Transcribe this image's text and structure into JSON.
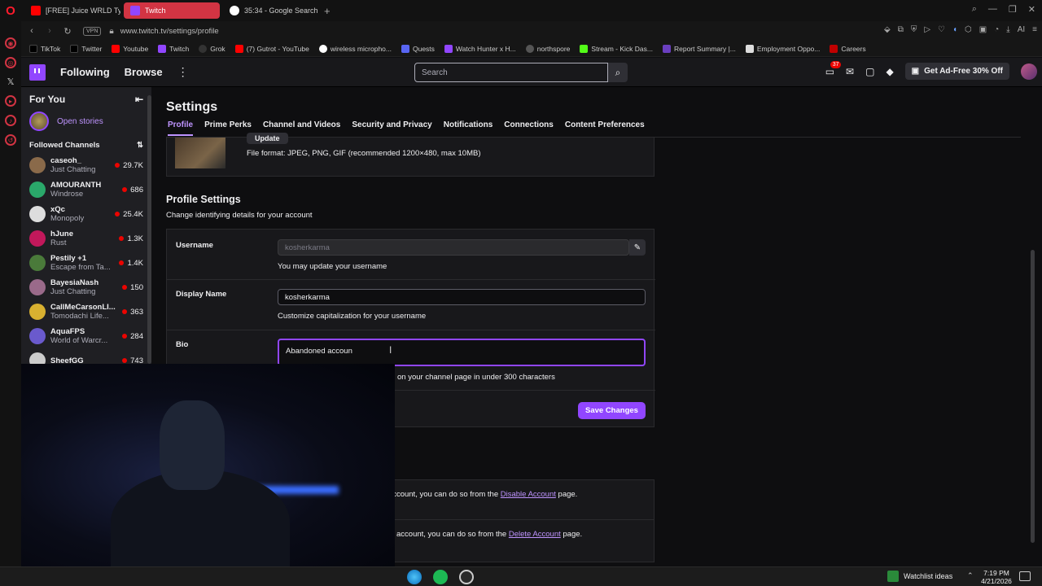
{
  "browser": {
    "tabs": [
      {
        "label": "[FREE] Juice WRLD Ty",
        "color": "#ff0000"
      },
      {
        "label": "Twitch",
        "color": "#9146ff",
        "active": true
      },
      {
        "label": "35:34 - Google Search",
        "color": "#ffffff"
      }
    ],
    "new_tab": "+",
    "vpn": "VPN",
    "url": "www.twitch.tv/settings/profile",
    "ai_label": "AI",
    "bookmarks": [
      {
        "label": "TikTok",
        "color": "#111111"
      },
      {
        "label": "Twitter",
        "color": "#111111"
      },
      {
        "label": "Youtube",
        "color": "#ff0000"
      },
      {
        "label": "Twitch",
        "color": "#9146ff"
      },
      {
        "label": "Grok",
        "color": "#333333"
      },
      {
        "label": "(7) Gutrot - YouTube",
        "color": "#ff0000"
      },
      {
        "label": "wireless micropho...",
        "color": "#ffffff"
      },
      {
        "label": "Quests",
        "color": "#5865f2"
      },
      {
        "label": "Watch Hunter x H...",
        "color": "#9146ff"
      },
      {
        "label": "northspore",
        "color": "#555555"
      },
      {
        "label": "Stream - Kick Das...",
        "color": "#53fc18"
      },
      {
        "label": "Report Summary |...",
        "color": "#6a3fbf"
      },
      {
        "label": "Employment Oppo...",
        "color": "#dddddd"
      },
      {
        "label": "Careers",
        "color": "#c00000"
      }
    ]
  },
  "twitch_nav": {
    "following": "Following",
    "browse": "Browse",
    "search_placeholder": "Search",
    "notif_count": "37",
    "adfree": "Get Ad-Free 30% Off"
  },
  "left_nav": {
    "for_you": "For You",
    "open_stories": "Open stories",
    "followed_channels": "Followed Channels",
    "channels": [
      {
        "name": "caseoh_",
        "game": "Just Chatting",
        "viewers": "29.7K",
        "color": "#8a6a4a"
      },
      {
        "name": "AMOURANTH",
        "game": "Windrose",
        "viewers": "686",
        "color": "#2aa86a"
      },
      {
        "name": "xQc",
        "game": "Monopoly",
        "viewers": "25.4K",
        "color": "#dddddd"
      },
      {
        "name": "hJune",
        "game": "Rust",
        "viewers": "1.3K",
        "color": "#c2185b"
      },
      {
        "name": "Pestily +1",
        "game": "Escape from Ta...",
        "viewers": "1.4K",
        "color": "#4a7a3a"
      },
      {
        "name": "BayesiaNash",
        "game": "Just Chatting",
        "viewers": "150",
        "color": "#9a6a8a"
      },
      {
        "name": "CallMeCarsonLI...",
        "game": "Tomodachi Life...",
        "viewers": "363",
        "color": "#d8b030"
      },
      {
        "name": "AquaFPS",
        "game": "World of Warcr...",
        "viewers": "284",
        "color": "#6a5acd"
      },
      {
        "name": "SheefGG",
        "game": "",
        "viewers": "743",
        "color": "#cccccc"
      }
    ]
  },
  "settings": {
    "title": "Settings",
    "tabs": [
      "Profile",
      "Prime Perks",
      "Channel and Videos",
      "Security and Privacy",
      "Notifications",
      "Connections",
      "Content Preferences"
    ],
    "update_btn": "Update",
    "file_format": "File format: JPEG, PNG, GIF (recommended 1200×480, max 10MB)",
    "profile_settings_title": "Profile Settings",
    "profile_settings_sub": "Change identifying details for your account",
    "username_label": "Username",
    "username_value": "kosherkarma",
    "username_hint": "You may update your username",
    "display_name_label": "Display Name",
    "display_name_value": "kosherkarma",
    "display_name_hint": "Customize capitalization for your username",
    "bio_label": "Bio",
    "bio_value": "Abandoned accoun",
    "bio_hint": "on your channel page in under 300 characters",
    "save_btn": "Save Changes",
    "disable_text_pre": "h account, you can do so from the",
    "disable_link": "Disable Account",
    "disable_text_post": "page.",
    "delete_text_pre": "account, you can do so from the",
    "delete_link": "Delete Account",
    "delete_text_post": "page."
  },
  "taskbar": {
    "weather": "Watchlist ideas",
    "time": "7:19 PM",
    "date": "4/21/2026"
  }
}
